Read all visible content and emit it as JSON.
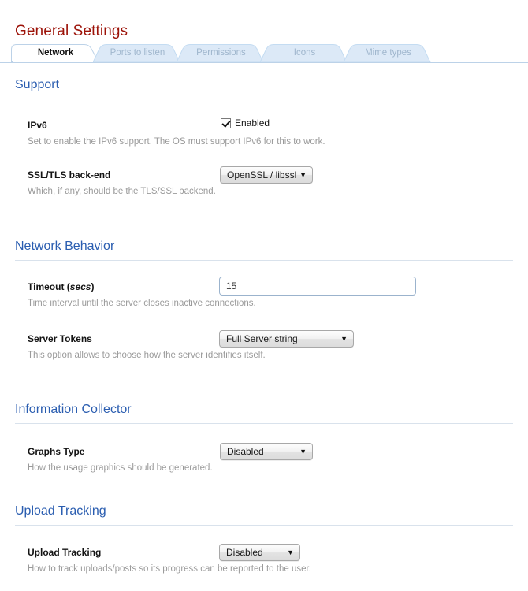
{
  "page": {
    "title": "General Settings",
    "title_color": "#9c1208"
  },
  "tabs": {
    "active_index": 0,
    "items": [
      {
        "label": "Network"
      },
      {
        "label": "Ports to listen"
      },
      {
        "label": "Permissions"
      },
      {
        "label": "Icons"
      },
      {
        "label": "Mime types"
      }
    ]
  },
  "sections": [
    {
      "title": "Support",
      "rows": [
        {
          "label": "IPv6",
          "help": "Set to enable the IPv6 support. The OS must support IPv6 for this to work.",
          "control": "checkbox",
          "checkbox_label": "Enabled",
          "checked": true
        },
        {
          "label": "SSL/TLS back-end",
          "help": "Which, if any, should be the TLS/SSL backend.",
          "control": "select",
          "value": "OpenSSL / libssl"
        }
      ]
    },
    {
      "title": "Network Behavior",
      "rows": [
        {
          "label_pre": "Timeout (",
          "label_em": "secs",
          "label_post": ")",
          "help": "Time interval until the server closes inactive connections.",
          "control": "text",
          "value": "15"
        },
        {
          "label": "Server Tokens",
          "help": "This option allows to choose how the server identifies itself.",
          "control": "select",
          "value": "Full Server string"
        }
      ]
    },
    {
      "title": "Information Collector",
      "rows": [
        {
          "label": "Graphs Type",
          "help": "How the usage graphics should be generated.",
          "control": "select",
          "value": "Disabled"
        }
      ]
    },
    {
      "title": "Upload Tracking",
      "rows": [
        {
          "label": "Upload Tracking",
          "help": "How to track uploads/posts so its progress can be reported to the user.",
          "control": "select",
          "value": "Disabled"
        }
      ]
    }
  ],
  "icons": {
    "dropdown_arrow": "▼",
    "checkmark": "check-mark"
  },
  "colors": {
    "title": "#9c1208",
    "section_heading": "#2a5db0",
    "tab_inactive_text": "#9fb6cd",
    "tab_inactive_bg": "#dce9f7",
    "help_text": "#9a9a9a",
    "rule": "#d9e2ec"
  }
}
